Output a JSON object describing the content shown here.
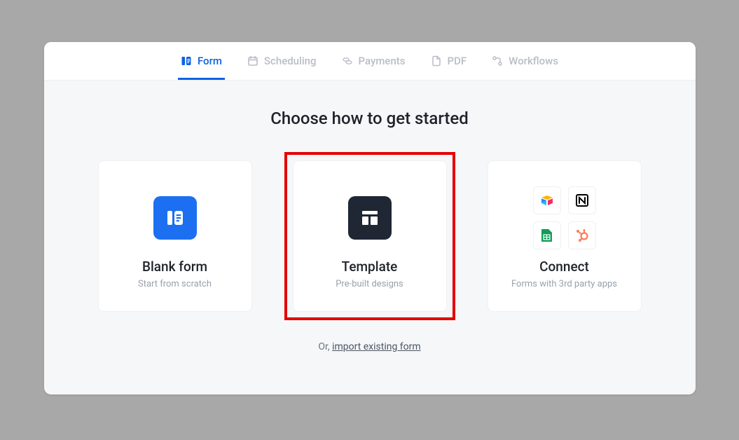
{
  "tabs": [
    {
      "label": "Form",
      "active": true
    },
    {
      "label": "Scheduling",
      "active": false
    },
    {
      "label": "Payments",
      "active": false
    },
    {
      "label": "PDF",
      "active": false
    },
    {
      "label": "Workflows",
      "active": false
    }
  ],
  "title": "Choose how to get started",
  "cards": {
    "blank": {
      "title": "Blank form",
      "subtitle": "Start from scratch"
    },
    "template": {
      "title": "Template",
      "subtitle": "Pre-built designs"
    },
    "connect": {
      "title": "Connect",
      "subtitle": "Forms with 3rd party apps"
    }
  },
  "import": {
    "prefix": "Or, ",
    "link": "import existing form"
  },
  "colors": {
    "accent": "#0e63e3",
    "highlight": "#e40000",
    "dark": "#1f2634"
  }
}
